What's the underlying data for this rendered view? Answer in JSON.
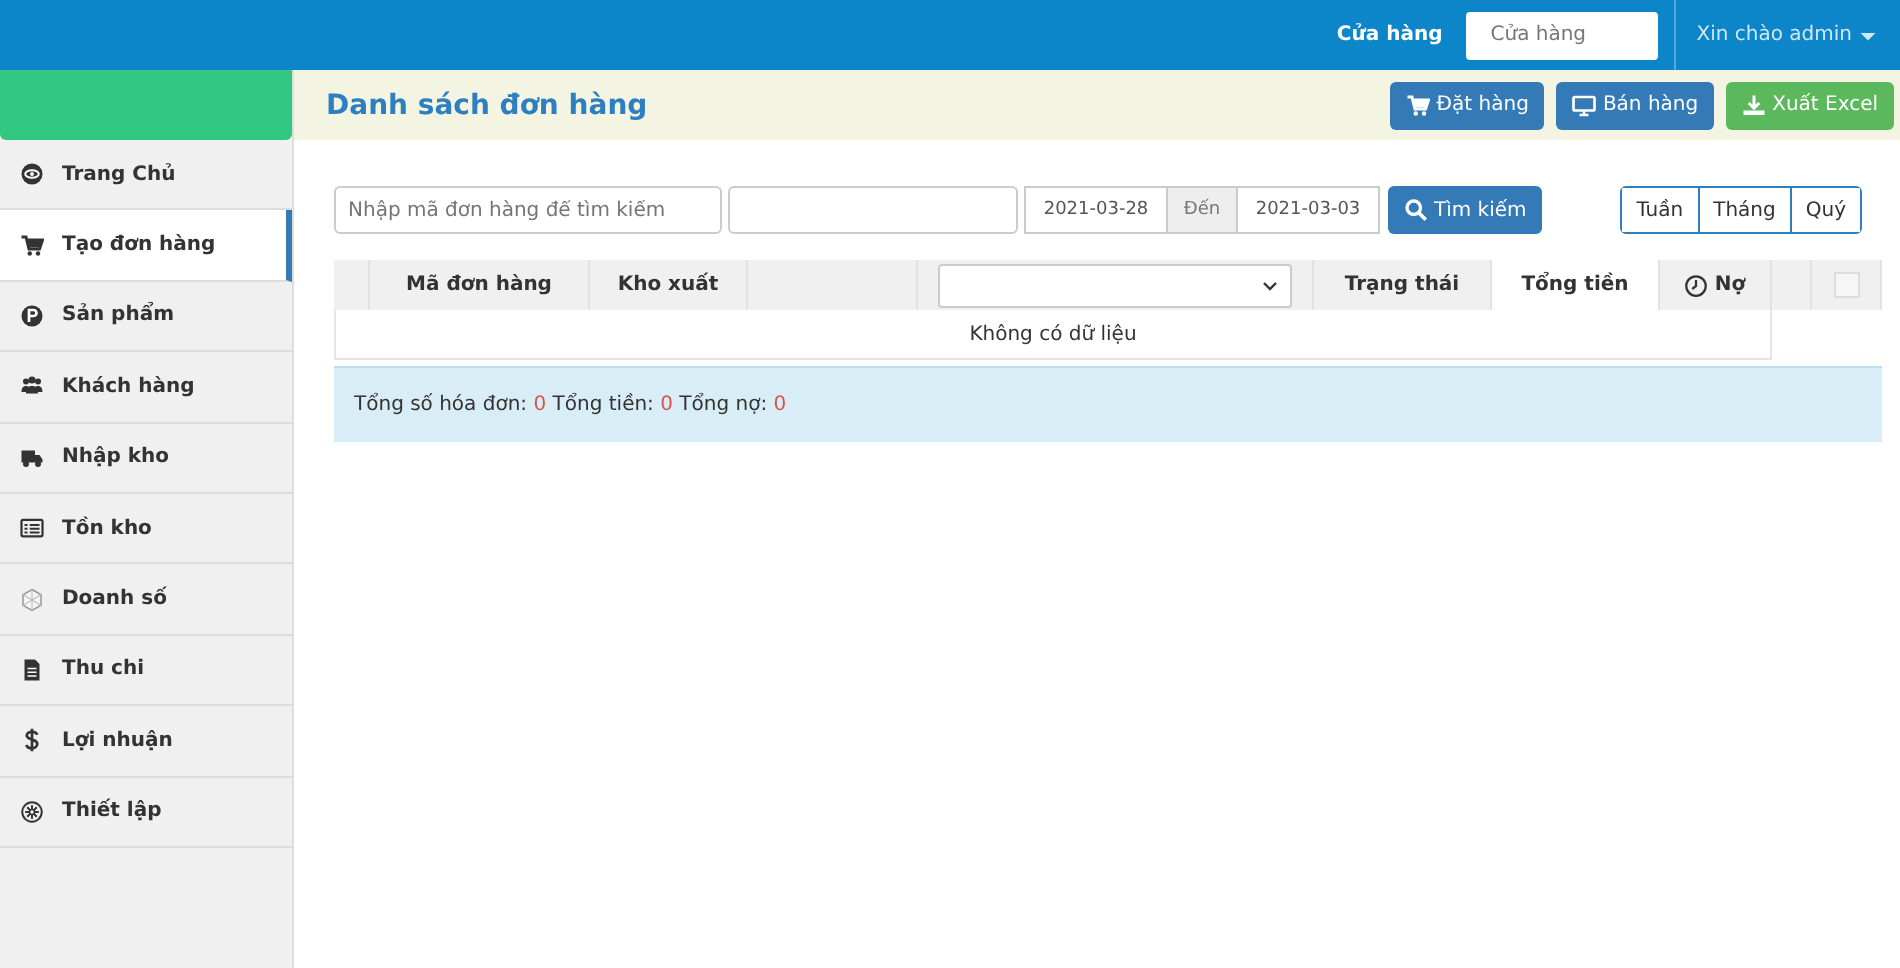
{
  "topbar": {
    "store_label": "Cửa hàng",
    "store_select": "Cửa hàng",
    "user": "Xin chào admin"
  },
  "sidebar": {
    "items": [
      {
        "label": "Trang Chủ",
        "selected": false
      },
      {
        "label": "Tạo đơn hàng",
        "selected": true
      },
      {
        "label": "Sản phẩm",
        "selected": false
      },
      {
        "label": "Khách hàng",
        "selected": false
      },
      {
        "label": "Nhập kho",
        "selected": false
      },
      {
        "label": "Tồn kho",
        "selected": false
      },
      {
        "label": "Doanh số",
        "selected": false
      },
      {
        "label": "Thu chi",
        "selected": false
      },
      {
        "label": "Lợi nhuận",
        "selected": false
      },
      {
        "label": "Thiết lập",
        "selected": false
      }
    ]
  },
  "page_title": "Danh sách đơn hàng",
  "actions": [
    {
      "label": "Đặt hàng",
      "kind": "order"
    },
    {
      "label": "Bán hàng",
      "kind": "sell"
    },
    {
      "label": "Xuất Excel",
      "kind": "export"
    }
  ],
  "filters": {
    "search_placeholder": "Nhập mã đơn hàng để tìm kiếm",
    "date_from": "2021-03-28",
    "date_to_label": "Đến",
    "date_to": "2021-03-03",
    "search_button": "Tìm kiếm"
  },
  "periods": [
    {
      "label": "Tuần",
      "selected": false
    },
    {
      "label": "Tháng",
      "selected": false
    },
    {
      "label": "Quý",
      "selected": false
    }
  ],
  "table": {
    "columns": [
      {
        "kind": "blank"
      },
      {
        "kind": "text",
        "label": "Mã đơn hàng"
      },
      {
        "kind": "text",
        "label": "Kho xuất"
      },
      {
        "kind": "blank"
      },
      {
        "kind": "select"
      },
      {
        "kind": "text",
        "label": "Trạng thái"
      },
      {
        "kind": "text",
        "label": "Tổng tiền"
      },
      {
        "kind": "clock",
        "label": "Nợ"
      },
      {
        "kind": "blank"
      },
      {
        "kind": "checkbox",
        "checked": false
      }
    ],
    "empty_message": "Không có dữ liệu"
  },
  "summary": [
    {
      "label": "Tổng số hóa đơn:",
      "value": "0"
    },
    {
      "label": "Tổng tiền:",
      "value": "0"
    },
    {
      "label": "Tổng nợ:",
      "value": "0"
    }
  ]
}
